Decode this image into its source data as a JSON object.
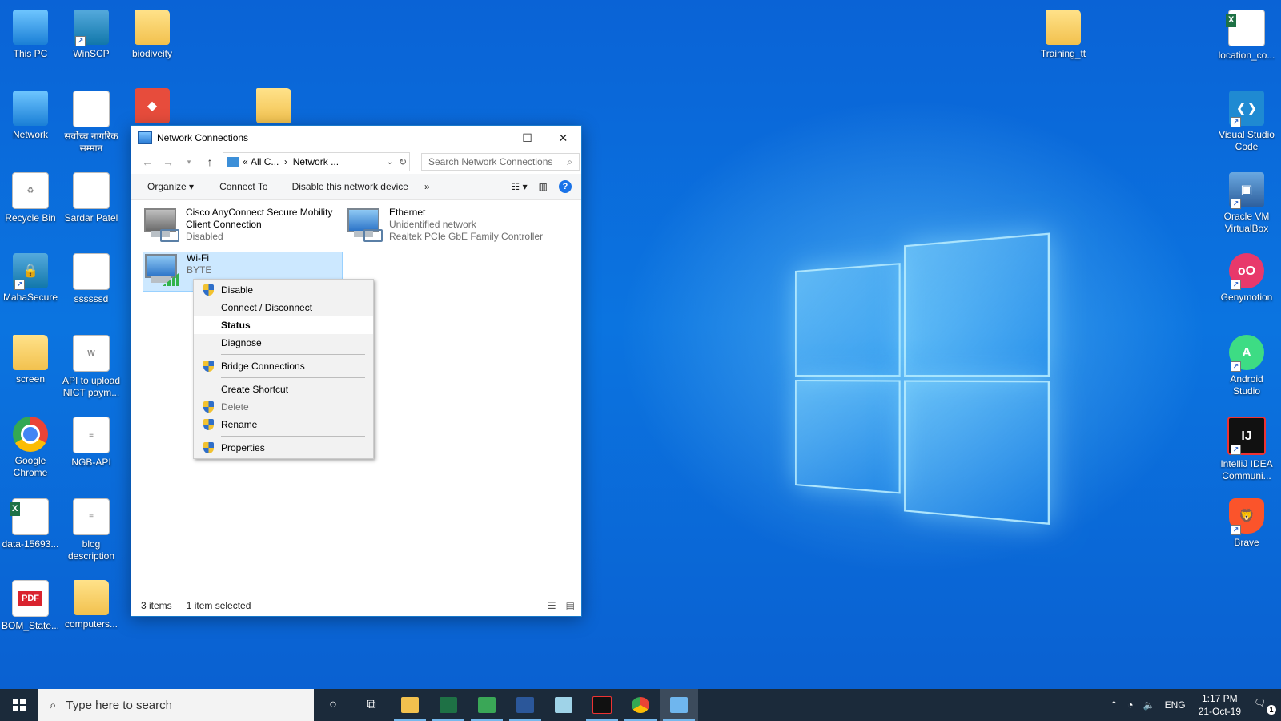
{
  "desktop": {
    "icons_left": [
      {
        "label": "This PC",
        "kind": "pc"
      },
      {
        "label": "WinSCP",
        "kind": "shield"
      },
      {
        "label": "biodiveity",
        "kind": "folder"
      },
      {
        "label": "Network",
        "kind": "pc"
      },
      {
        "label": "सर्वोच्च नागरिक सम्मान",
        "kind": "doc"
      },
      {
        "label": "Recycle Bin",
        "kind": "doc"
      },
      {
        "label": "Sardar Patel",
        "kind": "doc"
      },
      {
        "label": "MahaSecure",
        "kind": "shield"
      },
      {
        "label": "ssssssd",
        "kind": "doc"
      },
      {
        "label": "screen",
        "kind": "folder"
      },
      {
        "label": "API to upload NICT paym...",
        "kind": "doc"
      },
      {
        "label": "Google Chrome",
        "kind": "chrome"
      },
      {
        "label": "NGB-API",
        "kind": "doc"
      },
      {
        "label": "data-15693...",
        "kind": "excel"
      },
      {
        "label": "blog description",
        "kind": "doc"
      },
      {
        "label": "BOM_State...",
        "kind": "pdf"
      },
      {
        "label": "computers...",
        "kind": "folder"
      }
    ],
    "icons_right": [
      {
        "label": "Training_tt",
        "kind": "folder"
      },
      {
        "label": "location_co...",
        "kind": "excel"
      },
      {
        "label": "Visual Studio Code",
        "kind": "vscode"
      },
      {
        "label": "Oracle VM VirtualBox",
        "kind": "vbox"
      },
      {
        "label": "Genymotion",
        "kind": "geny"
      },
      {
        "label": "Android Studio",
        "kind": "android"
      },
      {
        "label": "IntelliJ IDEA Communi...",
        "kind": "intellij"
      },
      {
        "label": "Brave",
        "kind": "brave"
      }
    ],
    "pdf_badge": "PDF",
    "intellij_badge": "IJ"
  },
  "window": {
    "title": "Network Connections",
    "address_prefix": "«",
    "address_part1": "All C...",
    "address_sep": "›",
    "address_part2": "Network ...",
    "search_placeholder": "Search Network Connections",
    "commands": {
      "organize": "Organize",
      "connect_to": "Connect To",
      "disable_device": "Disable this network device",
      "more": "»"
    },
    "help": "?",
    "items": [
      {
        "name": "Cisco AnyConnect Secure Mobility",
        "name2": "Client Connection",
        "status": "Disabled",
        "detail": ""
      },
      {
        "name": "Ethernet",
        "name2": "",
        "status": "Unidentified network",
        "detail": "Realtek PCIe GbE Family Controller"
      },
      {
        "name": "Wi-Fi",
        "name2": "",
        "status": "BYTE",
        "detail": ""
      }
    ],
    "status_count": "3 items",
    "status_selected": "1 item selected"
  },
  "context_menu": {
    "items": [
      {
        "label": "Disable",
        "shield": true
      },
      {
        "label": "Connect / Disconnect",
        "shield": false
      },
      {
        "label": "Status",
        "shield": false
      },
      {
        "label": "Diagnose",
        "shield": false
      },
      {
        "label": "Bridge Connections",
        "shield": true
      },
      {
        "label": "Create Shortcut",
        "shield": false
      },
      {
        "label": "Delete",
        "shield": true
      },
      {
        "label": "Rename",
        "shield": true
      },
      {
        "label": "Properties",
        "shield": true
      }
    ]
  },
  "taskbar": {
    "search_placeholder": "Type here to search",
    "language": "ENG",
    "time": "1:17 PM",
    "date": "21-Oct-19",
    "notifications": "1"
  },
  "colors": {
    "accent": "#0078d7",
    "selection": "#cce8ff",
    "taskbar": "#1b2a3a"
  }
}
